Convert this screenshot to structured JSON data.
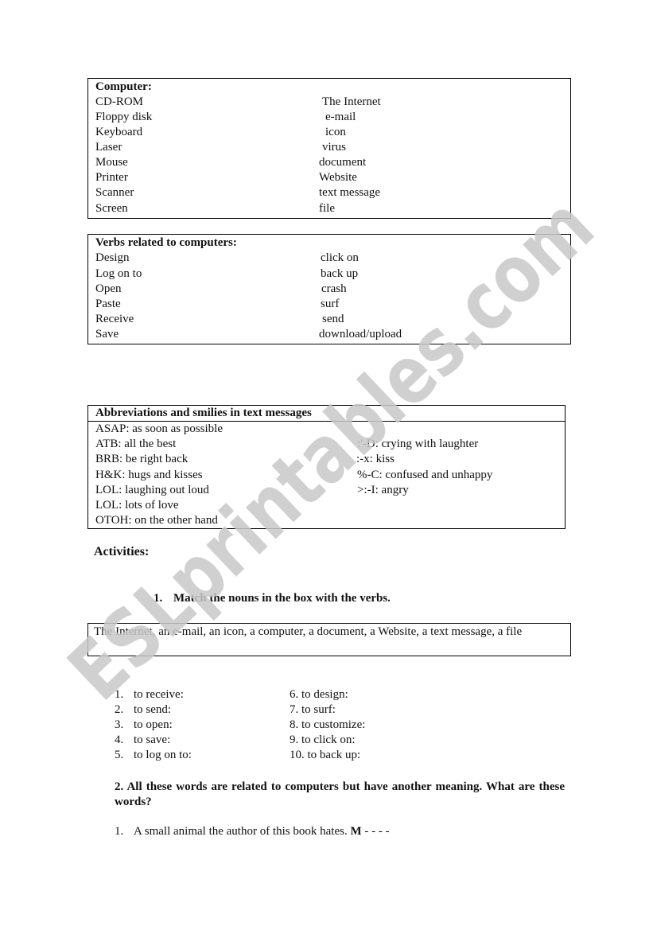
{
  "computer_box": {
    "title": "Computer:",
    "left": [
      "CD-ROM",
      "Floppy disk",
      "Keyboard",
      "Laser",
      "Mouse",
      "Printer",
      "Scanner",
      "Screen"
    ],
    "right": [
      "The Internet",
      "e-mail",
      "icon",
      "virus",
      "document",
      "Website",
      "text message",
      "file"
    ]
  },
  "verbs_box": {
    "title": "Verbs related to computers:",
    "left": [
      "Design",
      "Log on to",
      "Open",
      "Paste",
      "Receive",
      "Save"
    ],
    "right": [
      "click on",
      "back up",
      "crash",
      "surf",
      "send",
      "download/upload"
    ]
  },
  "abbr_box": {
    "title": "Abbreviations and smilies in text messages",
    "left": [
      "ASAP: as soon as possible",
      "ATB: all the best",
      "BRB: be right back",
      "H&K: hugs and kisses",
      "LOL: laughing out loud",
      "LOL: lots of love",
      "OTOH: on the other hand"
    ],
    "right": [
      "",
      ":'-D: crying with laughter",
      ":-x: kiss",
      "%-C: confused and unhappy",
      ">:-I: angry",
      "",
      ""
    ]
  },
  "activities": {
    "heading": "Activities:",
    "task1": {
      "number": "1.",
      "instruction": "Match the nouns in the box with the verbs.",
      "nouns_box": "The Internet, an e-mail, an icon, a computer, a document, a Website, a text message, a file",
      "left_items": [
        {
          "n": "1.",
          "text": "to receive:"
        },
        {
          "n": "2.",
          "text": "to send:"
        },
        {
          "n": "3.",
          "text": "to open:"
        },
        {
          "n": "4.",
          "text": "to save:"
        },
        {
          "n": "5.",
          "text": "to log on to:"
        }
      ],
      "right_items": [
        "6. to design:",
        "7. to surf:",
        "8. to customize:",
        "9. to click on:",
        "10. to back up:"
      ]
    },
    "task2": {
      "instruction": "2. All these words are related to computers but have another meaning. What are these words?",
      "q1_number": "1.",
      "q1_text": "A small animal the author of this book hates.",
      "q1_hint_letter": "M",
      "q1_blanks": " - - - -"
    }
  },
  "watermark": {
    "text": "ESLprintables.com",
    "color": "#c8c8c8"
  }
}
